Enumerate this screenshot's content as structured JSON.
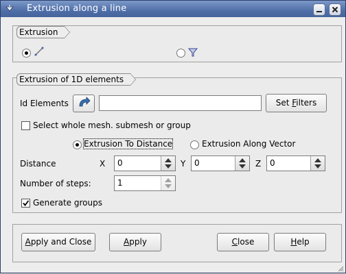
{
  "window": {
    "title": "Extrusion along a line"
  },
  "extrusion_group": {
    "title": "Extrusion",
    "options": [
      {
        "icon": "line-segment-icon",
        "checked": true
      },
      {
        "icon": "funnel-filter-icon",
        "checked": false
      }
    ]
  },
  "elements_group": {
    "title": "Extrusion of 1D elements",
    "id_elements_label": "Id Elements",
    "id_elements_value": "",
    "set_filters_prefix": "Set ",
    "set_filters_underlined": "F",
    "set_filters_suffix": "ilters",
    "select_whole_label": "Select whole mesh. submesh or group",
    "mode_distance_label": "Extrusion To Distance",
    "mode_vector_label": "Extrusion Along Vector",
    "distance_label": "Distance",
    "x_label": "X",
    "x_value": "0",
    "y_label": "Y",
    "y_value": "0",
    "z_label": "Z",
    "z_value": "0",
    "steps_label": "Number of steps:",
    "steps_value": "1",
    "generate_groups_label": "Generate groups"
  },
  "buttons": {
    "apply_close_prefix": "",
    "apply_close_underlined": "A",
    "apply_close_suffix": "pply and Close",
    "apply_prefix": "",
    "apply_underlined": "A",
    "apply_suffix": "pply",
    "close_prefix": "",
    "close_underlined": "C",
    "close_suffix": "lose",
    "help_prefix": "",
    "help_underlined": "H",
    "help_suffix": "elp"
  }
}
